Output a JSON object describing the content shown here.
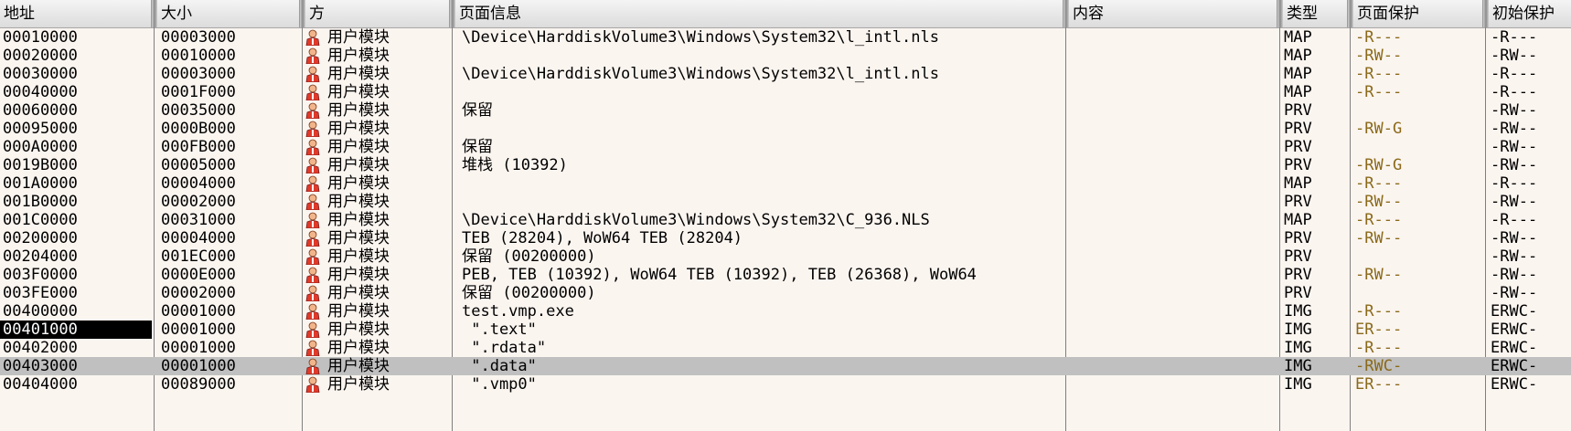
{
  "headers": {
    "address": "地址",
    "size": "大小",
    "party": "方",
    "page_info": "页面信息",
    "content": "内容",
    "type": "类型",
    "page_protection": "页面保护",
    "initial_protection": "初始保护"
  },
  "icons": {
    "user_module": "user-module-icon"
  },
  "colors": {
    "protection_text": "#8a6a1a",
    "selected_row": "#c0c0c0",
    "focus_cell": "#000000"
  },
  "rows": [
    {
      "address": "00010000",
      "size": "00003000",
      "party": "用户模块",
      "info": "\\Device\\HarddiskVolume3\\Windows\\System32\\l_intl.nls",
      "content": "",
      "type": "MAP",
      "protect": "-R---",
      "init_protect": "-R---"
    },
    {
      "address": "00020000",
      "size": "00010000",
      "party": "用户模块",
      "info": "",
      "content": "",
      "type": "MAP",
      "protect": "-RW--",
      "init_protect": "-RW--"
    },
    {
      "address": "00030000",
      "size": "00003000",
      "party": "用户模块",
      "info": "\\Device\\HarddiskVolume3\\Windows\\System32\\l_intl.nls",
      "content": "",
      "type": "MAP",
      "protect": "-R---",
      "init_protect": "-R---"
    },
    {
      "address": "00040000",
      "size": "0001F000",
      "party": "用户模块",
      "info": "",
      "content": "",
      "type": "MAP",
      "protect": "-R---",
      "init_protect": "-R---"
    },
    {
      "address": "00060000",
      "size": "00035000",
      "party": "用户模块",
      "info": "保留",
      "content": "",
      "type": "PRV",
      "protect": "",
      "init_protect": "-RW--"
    },
    {
      "address": "00095000",
      "size": "0000B000",
      "party": "用户模块",
      "info": "",
      "content": "",
      "type": "PRV",
      "protect": "-RW-G",
      "init_protect": "-RW--"
    },
    {
      "address": "000A0000",
      "size": "000FB000",
      "party": "用户模块",
      "info": "保留",
      "content": "",
      "type": "PRV",
      "protect": "",
      "init_protect": "-RW--"
    },
    {
      "address": "0019B000",
      "size": "00005000",
      "party": "用户模块",
      "info": "堆栈 (10392)",
      "content": "",
      "type": "PRV",
      "protect": "-RW-G",
      "init_protect": "-RW--"
    },
    {
      "address": "001A0000",
      "size": "00004000",
      "party": "用户模块",
      "info": "",
      "content": "",
      "type": "MAP",
      "protect": "-R---",
      "init_protect": "-R---"
    },
    {
      "address": "001B0000",
      "size": "00002000",
      "party": "用户模块",
      "info": "",
      "content": "",
      "type": "PRV",
      "protect": "-RW--",
      "init_protect": "-RW--"
    },
    {
      "address": "001C0000",
      "size": "00031000",
      "party": "用户模块",
      "info": "\\Device\\HarddiskVolume3\\Windows\\System32\\C_936.NLS",
      "content": "",
      "type": "MAP",
      "protect": "-R---",
      "init_protect": "-R---"
    },
    {
      "address": "00200000",
      "size": "00004000",
      "party": "用户模块",
      "info": "TEB (28204), WoW64 TEB (28204)",
      "content": "",
      "type": "PRV",
      "protect": "-RW--",
      "init_protect": "-RW--"
    },
    {
      "address": "00204000",
      "size": "001EC000",
      "party": "用户模块",
      "info": "保留 (00200000)",
      "content": "",
      "type": "PRV",
      "protect": "",
      "init_protect": "-RW--"
    },
    {
      "address": "003F0000",
      "size": "0000E000",
      "party": "用户模块",
      "info": "PEB, TEB (10392), WoW64 TEB (10392), TEB (26368), WoW64",
      "content": "",
      "type": "PRV",
      "protect": "-RW--",
      "init_protect": "-RW--"
    },
    {
      "address": "003FE000",
      "size": "00002000",
      "party": "用户模块",
      "info": "保留 (00200000)",
      "content": "",
      "type": "PRV",
      "protect": "",
      "init_protect": "-RW--"
    },
    {
      "address": "00400000",
      "size": "00001000",
      "party": "用户模块",
      "info": "test.vmp.exe",
      "content": "",
      "type": "IMG",
      "protect": "-R---",
      "init_protect": "ERWC-"
    },
    {
      "address": "00401000",
      "size": "00001000",
      "party": "用户模块",
      "info": " \".text\"",
      "content": "",
      "type": "IMG",
      "protect": "ER---",
      "init_protect": "ERWC-"
    },
    {
      "address": "00402000",
      "size": "00001000",
      "party": "用户模块",
      "info": " \".rdata\"",
      "content": "",
      "type": "IMG",
      "protect": "-R---",
      "init_protect": "ERWC-"
    },
    {
      "address": "00403000",
      "size": "00001000",
      "party": "用户模块",
      "info": " \".data\"",
      "content": "",
      "type": "IMG",
      "protect": "-RWC-",
      "init_protect": "ERWC-"
    },
    {
      "address": "00404000",
      "size": "00089000",
      "party": "用户模块",
      "info": " \".vmp0\"",
      "content": "",
      "type": "IMG",
      "protect": "ER---",
      "init_protect": "ERWC-"
    }
  ],
  "state": {
    "focused_row": 16,
    "selected_row": 18
  }
}
